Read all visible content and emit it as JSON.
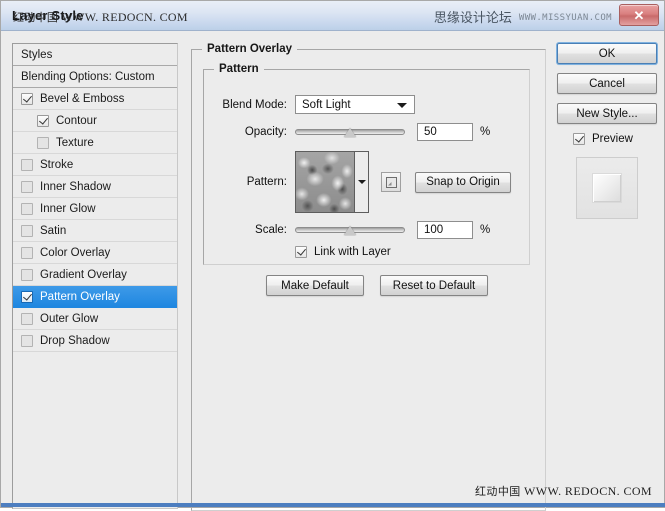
{
  "window": {
    "title": "Layer Style",
    "title_watermark_cn": "红动中国",
    "title_watermark_url": "WWW. REDOCN. COM",
    "brand_cn": "思缘设计论坛",
    "brand_url": "WWW.MISSYUAN.COM",
    "close_label": "✕"
  },
  "styles_panel": {
    "header": "Styles",
    "blending": "Blending Options: Custom",
    "items": [
      {
        "label": "Bevel & Emboss",
        "checked": true,
        "indent": false,
        "selected": false
      },
      {
        "label": "Contour",
        "checked": true,
        "indent": true,
        "selected": false
      },
      {
        "label": "Texture",
        "checked": false,
        "indent": true,
        "selected": false
      },
      {
        "label": "Stroke",
        "checked": false,
        "indent": false,
        "selected": false
      },
      {
        "label": "Inner Shadow",
        "checked": false,
        "indent": false,
        "selected": false
      },
      {
        "label": "Inner Glow",
        "checked": false,
        "indent": false,
        "selected": false
      },
      {
        "label": "Satin",
        "checked": false,
        "indent": false,
        "selected": false
      },
      {
        "label": "Color Overlay",
        "checked": false,
        "indent": false,
        "selected": false
      },
      {
        "label": "Gradient Overlay",
        "checked": false,
        "indent": false,
        "selected": false
      },
      {
        "label": "Pattern Overlay",
        "checked": true,
        "indent": false,
        "selected": true
      },
      {
        "label": "Outer Glow",
        "checked": false,
        "indent": false,
        "selected": false
      },
      {
        "label": "Drop Shadow",
        "checked": false,
        "indent": false,
        "selected": false
      }
    ]
  },
  "main": {
    "group_title": "Pattern Overlay",
    "subgroup_title": "Pattern",
    "blend_mode_label": "Blend Mode:",
    "blend_mode_value": "Soft Light",
    "opacity_label": "Opacity:",
    "opacity_value": "50",
    "opacity_unit": "%",
    "opacity_percent": 50,
    "pattern_label": "Pattern:",
    "snap_to_origin_label": "Snap to Origin",
    "scale_label": "Scale:",
    "scale_value": "100",
    "scale_unit": "%",
    "scale_percent": 50,
    "link_with_layer_label": "Link with Layer",
    "link_with_layer_checked": true,
    "make_default_label": "Make Default",
    "reset_to_default_label": "Reset to Default"
  },
  "right": {
    "ok_label": "OK",
    "cancel_label": "Cancel",
    "new_style_label": "New Style...",
    "preview_label": "Preview",
    "preview_checked": true
  },
  "footer": {
    "watermark_cn": "红动中国",
    "watermark_url": "WWW. REDOCN. COM"
  },
  "colors": {
    "selection_blue": "#2089e1",
    "titlebar_blue": "#cddcef",
    "close_red": "#d97f7f",
    "bottom_strip": "#4d7ec0"
  }
}
